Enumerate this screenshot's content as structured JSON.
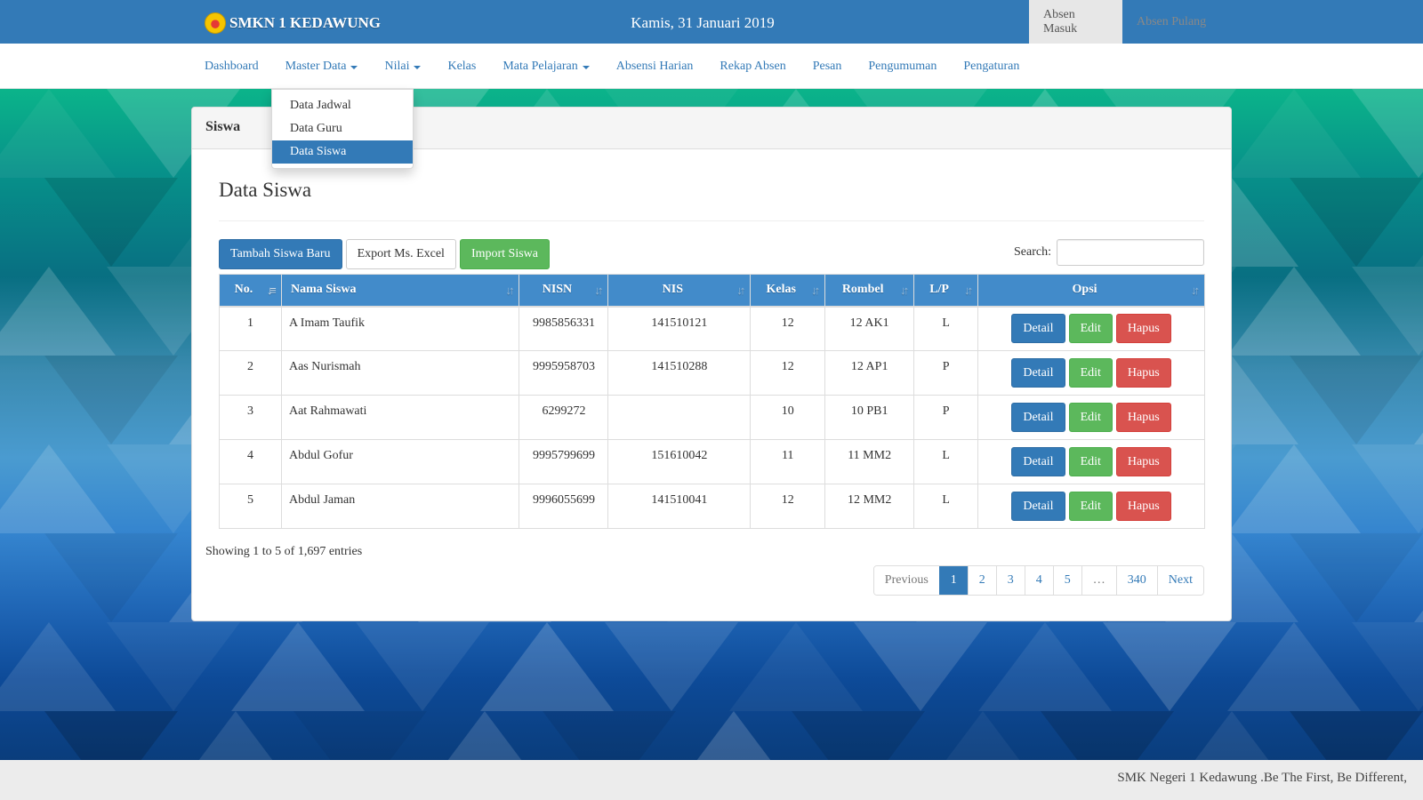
{
  "header": {
    "brand": "SMKN 1 KEDAWUNG",
    "logo_icon": "school-crest-logo",
    "date": "Kamis, 31 Januari 2019",
    "absen_masuk": "Absen Masuk",
    "absen_pulang": "Absen Pulang"
  },
  "nav": {
    "items": [
      {
        "label": "Dashboard",
        "dropdown": false
      },
      {
        "label": "Master Data",
        "dropdown": true
      },
      {
        "label": "Nilai",
        "dropdown": true
      },
      {
        "label": "Kelas",
        "dropdown": false
      },
      {
        "label": "Mata Pelajaran",
        "dropdown": true
      },
      {
        "label": "Absensi Harian",
        "dropdown": false
      },
      {
        "label": "Rekap Absen",
        "dropdown": false
      },
      {
        "label": "Pesan",
        "dropdown": false
      },
      {
        "label": "Pengumuman",
        "dropdown": false
      },
      {
        "label": "Pengaturan",
        "dropdown": false
      }
    ],
    "master_data_menu": [
      {
        "label": "Data Jadwal",
        "active": false
      },
      {
        "label": "Data Guru",
        "active": false
      },
      {
        "label": "Data Siswa",
        "active": true
      }
    ]
  },
  "panel": {
    "heading": "Siswa",
    "title": "Data Siswa",
    "buttons": {
      "add": "Tambah Siswa Baru",
      "export": "Export Ms. Excel",
      "import": "Import Siswa"
    },
    "search_label": "Search:",
    "search_value": ""
  },
  "table": {
    "columns": [
      "No.",
      "Nama Siswa",
      "NISN",
      "NIS",
      "Kelas",
      "Rombel",
      "L/P",
      "Opsi"
    ],
    "sorted_column": "No.",
    "rows": [
      {
        "no": "1",
        "nama": "A Imam Taufik",
        "nisn": "9985856331",
        "nis": "141510121",
        "kelas": "12",
        "rombel": "12 AK1",
        "lp": "L"
      },
      {
        "no": "2",
        "nama": "Aas Nurismah",
        "nisn": "9995958703",
        "nis": "141510288",
        "kelas": "12",
        "rombel": "12 AP1",
        "lp": "P"
      },
      {
        "no": "3",
        "nama": "Aat Rahmawati",
        "nisn": "6299272",
        "nis": "",
        "kelas": "10",
        "rombel": "10 PB1",
        "lp": "P"
      },
      {
        "no": "4",
        "nama": "Abdul Gofur",
        "nisn": "9995799699",
        "nis": "151610042",
        "kelas": "11",
        "rombel": "11 MM2",
        "lp": "L"
      },
      {
        "no": "5",
        "nama": "Abdul Jaman",
        "nisn": "9996055699",
        "nis": "141510041",
        "kelas": "12",
        "rombel": "12 MM2",
        "lp": "L"
      }
    ],
    "row_actions": {
      "detail": "Detail",
      "edit": "Edit",
      "delete": "Hapus"
    }
  },
  "info": "Showing 1 to 5 of 1,697 entries",
  "pagination": {
    "previous": "Previous",
    "pages": [
      "1",
      "2",
      "3",
      "4",
      "5",
      "…",
      "340"
    ],
    "current": "1",
    "next": "Next"
  },
  "footer": "SMK Negeri 1 Kedawung .Be The First, Be Different,",
  "colors": {
    "primary": "#337ab7",
    "table_header": "#428bca",
    "success": "#5cb85c",
    "danger": "#d9534f"
  }
}
